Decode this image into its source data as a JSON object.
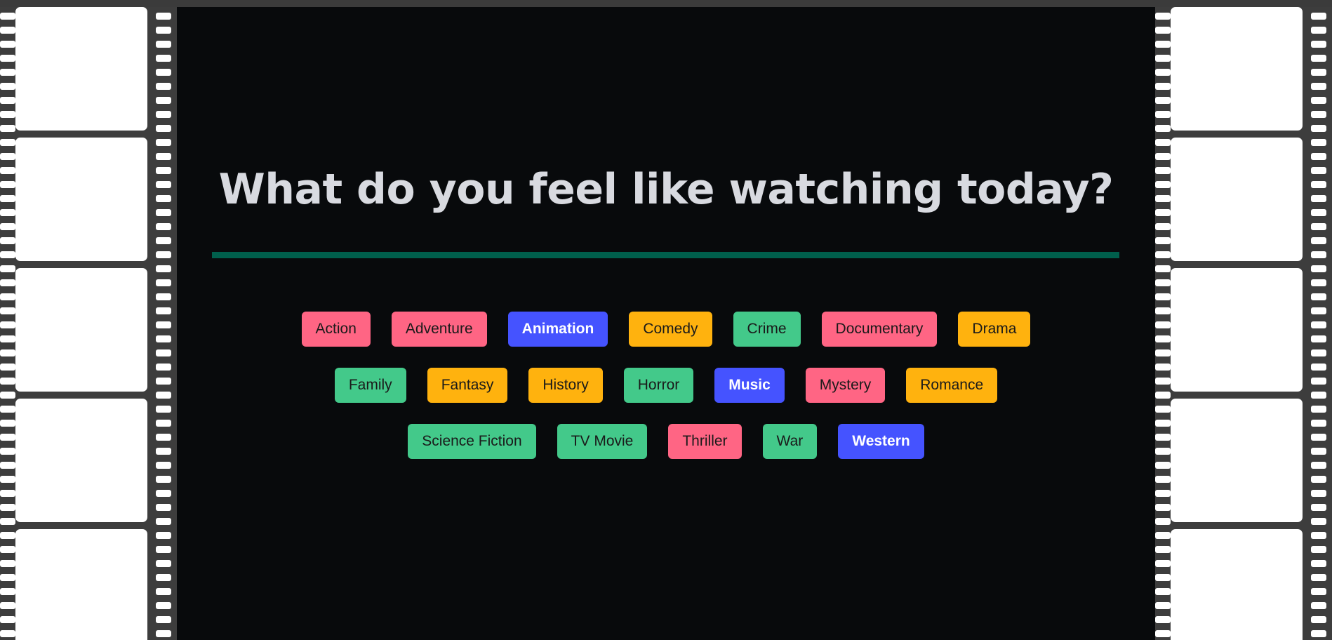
{
  "heading": "What do you feel like watching today?",
  "colors": {
    "pink": "#ff6584",
    "blue": "#4553ff",
    "yellow": "#ffb20e",
    "green": "#43c98a",
    "divider": "#005f4c",
    "background": "#080a0c"
  },
  "genres": [
    {
      "label": "Action",
      "color": "pink"
    },
    {
      "label": "Adventure",
      "color": "pink"
    },
    {
      "label": "Animation",
      "color": "blue"
    },
    {
      "label": "Comedy",
      "color": "yellow"
    },
    {
      "label": "Crime",
      "color": "green"
    },
    {
      "label": "Documentary",
      "color": "pink"
    },
    {
      "label": "Drama",
      "color": "yellow"
    },
    {
      "label": "Family",
      "color": "green"
    },
    {
      "label": "Fantasy",
      "color": "yellow"
    },
    {
      "label": "History",
      "color": "yellow"
    },
    {
      "label": "Horror",
      "color": "green"
    },
    {
      "label": "Music",
      "color": "blue"
    },
    {
      "label": "Mystery",
      "color": "pink"
    },
    {
      "label": "Romance",
      "color": "yellow"
    },
    {
      "label": "Science Fiction",
      "color": "green"
    },
    {
      "label": "TV Movie",
      "color": "green"
    },
    {
      "label": "Thriller",
      "color": "pink"
    },
    {
      "label": "War",
      "color": "green"
    },
    {
      "label": "Western",
      "color": "blue"
    }
  ]
}
